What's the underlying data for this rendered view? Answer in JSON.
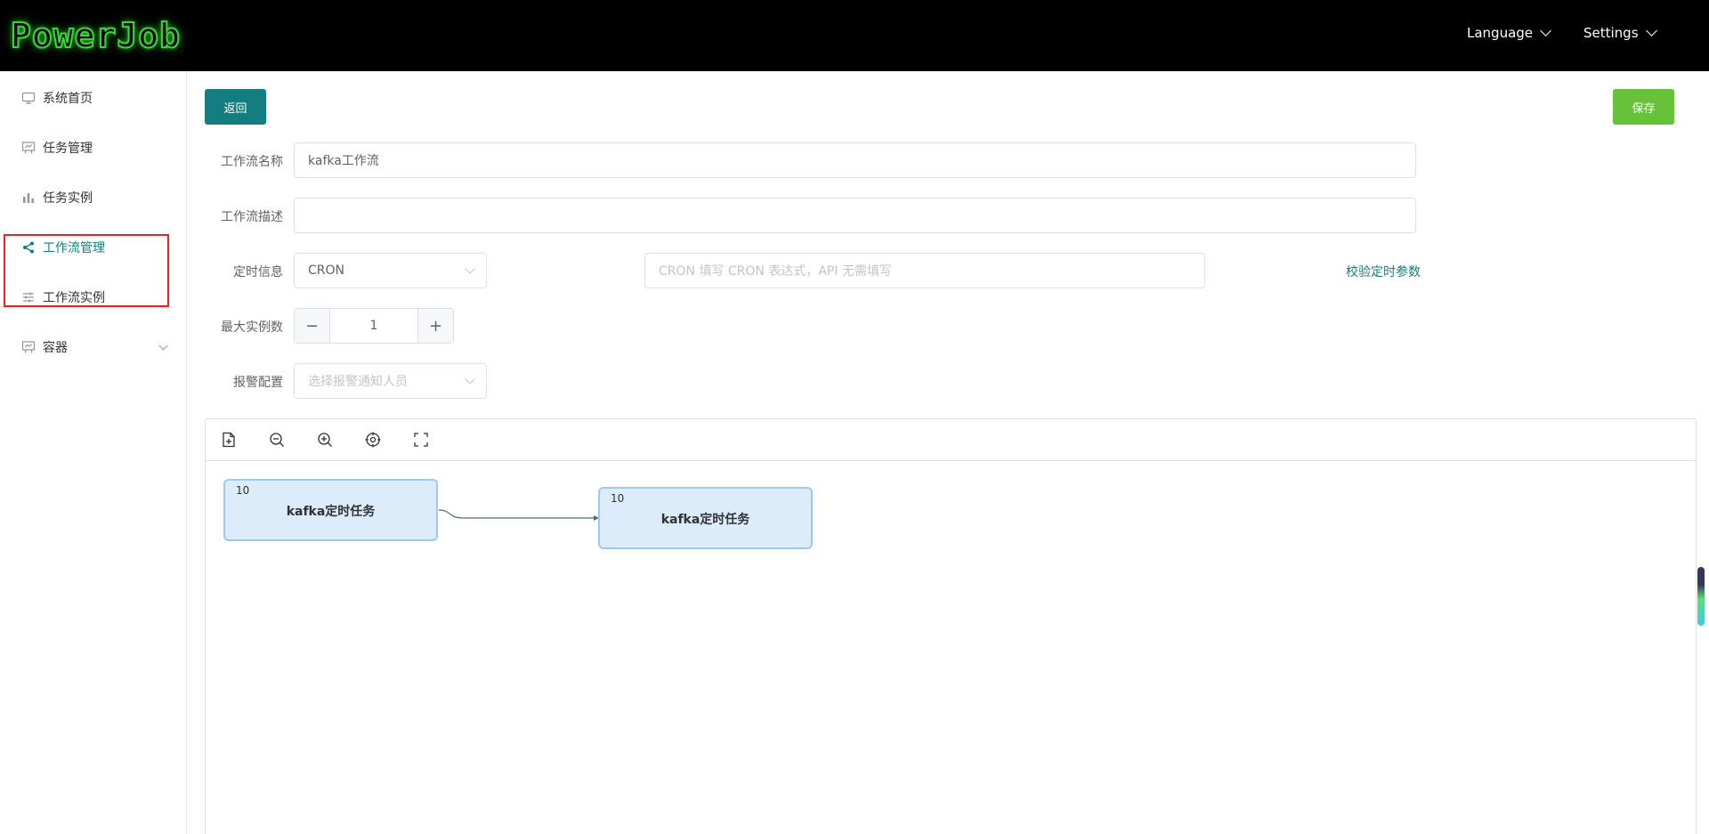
{
  "header": {
    "logo": "PowerJob",
    "language_label": "Language",
    "settings_label": "Settings"
  },
  "sidebar": {
    "items": [
      {
        "label": "系统首页",
        "icon": "monitor-icon"
      },
      {
        "label": "任务管理",
        "icon": "presentation-icon"
      },
      {
        "label": "任务实例",
        "icon": "bar-chart-icon"
      },
      {
        "label": "工作流管理",
        "icon": "share-icon",
        "active": true
      },
      {
        "label": "工作流实例",
        "icon": "sliders-icon"
      },
      {
        "label": "容器",
        "icon": "presentation-icon",
        "has_submenu": true
      }
    ]
  },
  "actions": {
    "back_label": "返回",
    "save_label": "保存"
  },
  "form": {
    "name_label": "工作流名称",
    "name_value": "kafka工作流",
    "desc_label": "工作流描述",
    "desc_value": "",
    "timing_label": "定时信息",
    "timing_type_value": "CRON",
    "timing_expression_placeholder": "CRON 填写 CRON 表达式，API 无需填写",
    "validate_link": "校验定时参数",
    "max_instances_label": "最大实例数",
    "max_instances_value": "1",
    "alarm_label": "报警配置",
    "alarm_placeholder": "选择报警通知人员"
  },
  "canvas": {
    "toolbar": [
      "add-node-icon",
      "zoom-out-icon",
      "zoom-in-icon",
      "locate-icon",
      "fullscreen-icon"
    ],
    "nodes": [
      {
        "id": "10",
        "name": "kafka定时任务"
      },
      {
        "id": "10",
        "name": "kafka定时任务"
      }
    ]
  },
  "colors": {
    "header_bg": "#000000",
    "accent": "#147d7f",
    "save": "#67c23a",
    "node_bg": "#dcecfb",
    "node_border": "#9cc9f0",
    "highlight": "#ff1a1a"
  }
}
